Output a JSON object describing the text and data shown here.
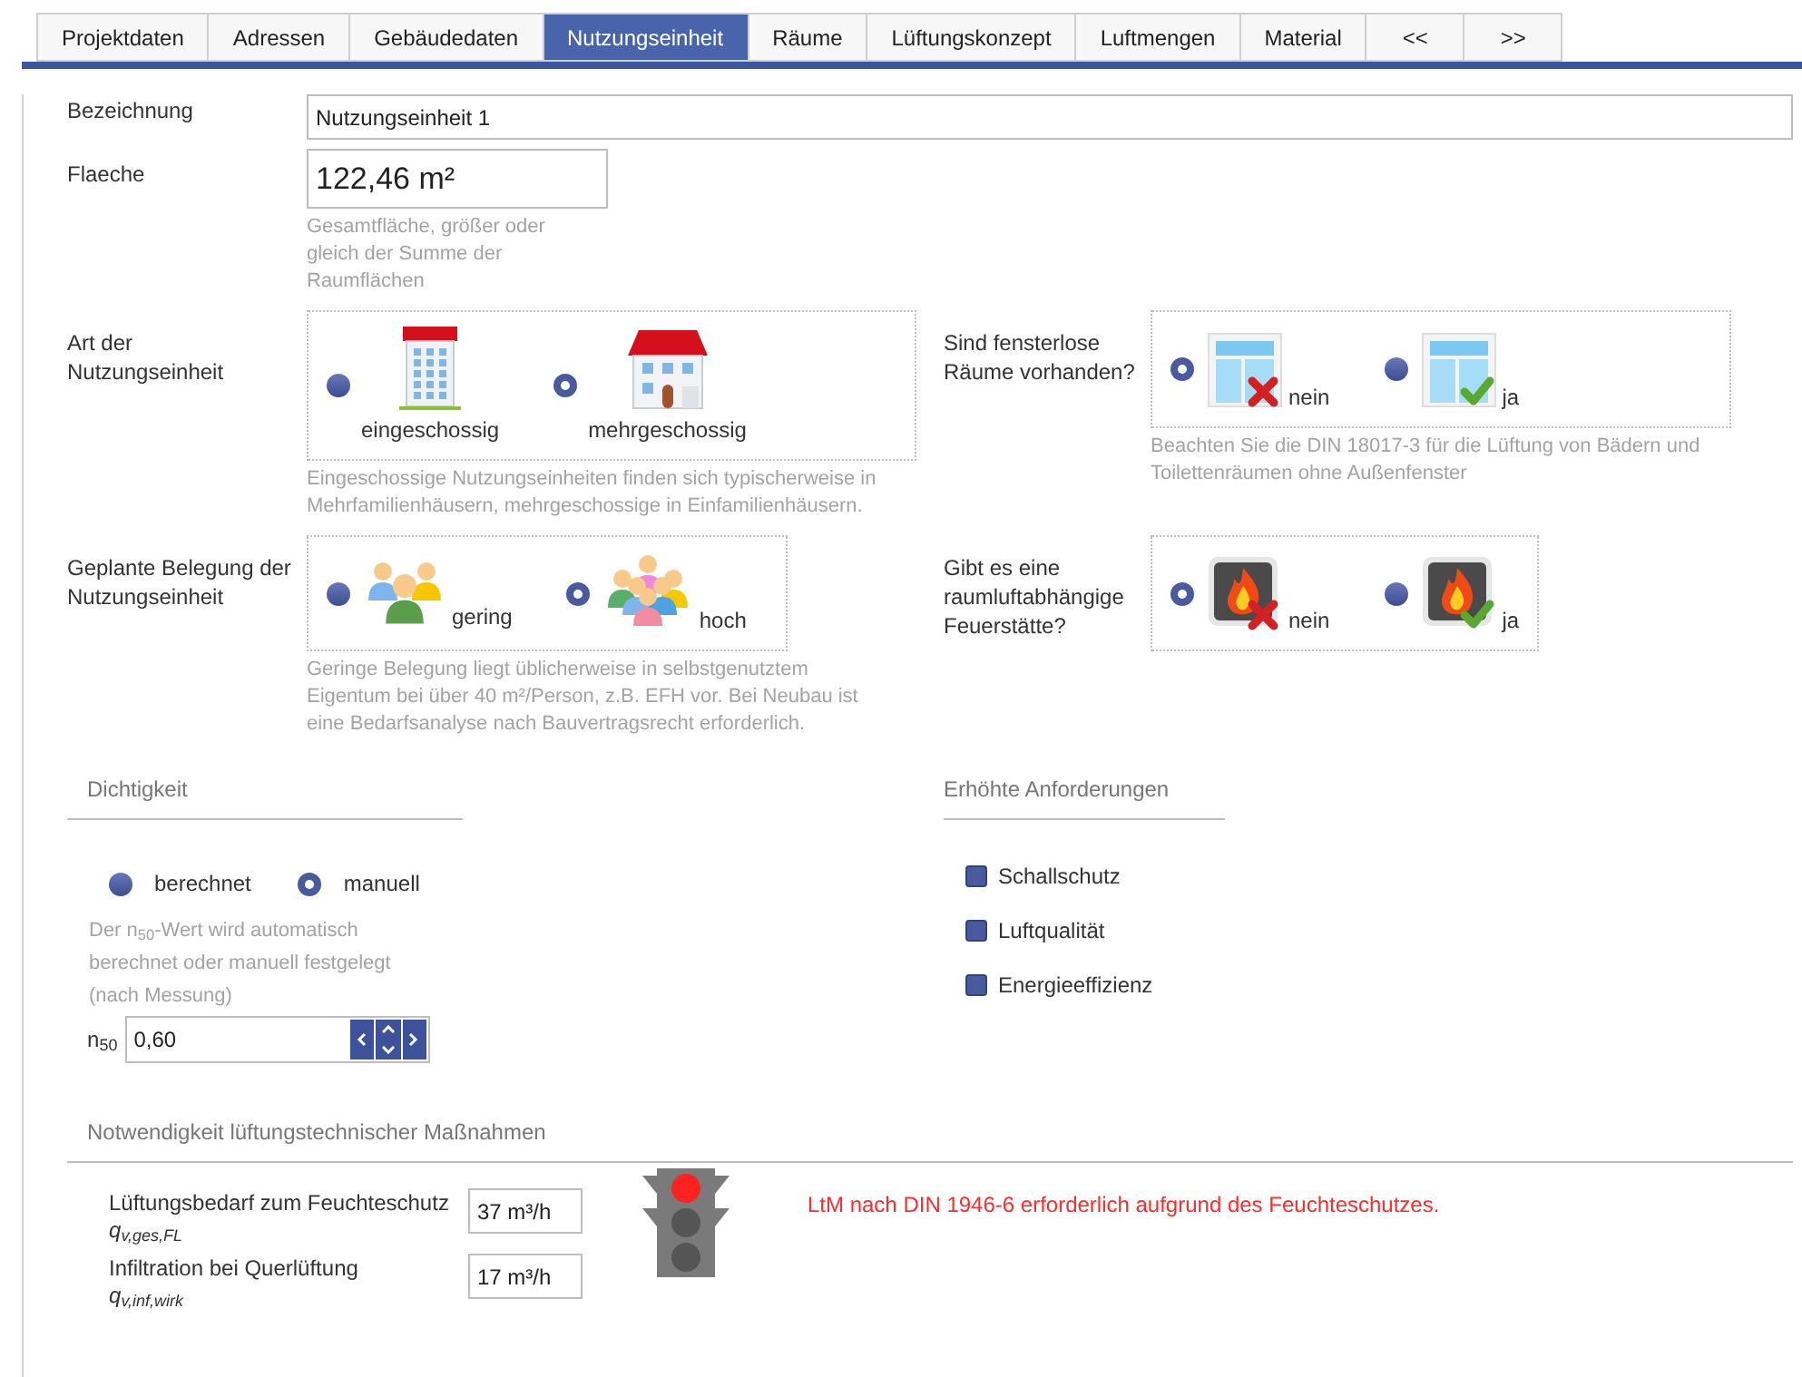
{
  "tabs": [
    {
      "label": "Projektdaten",
      "selected": false
    },
    {
      "label": "Adressen",
      "selected": false
    },
    {
      "label": "Gebäudedaten",
      "selected": false
    },
    {
      "label": "Nutzungseinheit",
      "selected": true
    },
    {
      "label": "Räume",
      "selected": false
    },
    {
      "label": "Lüftungskonzept",
      "selected": false
    },
    {
      "label": "Luftmengen",
      "selected": false
    },
    {
      "label": "Material",
      "selected": false
    },
    {
      "label": "<<",
      "selected": false
    },
    {
      "label": ">>",
      "selected": false
    }
  ],
  "bezeichnung": {
    "label": "Bezeichnung",
    "value": "Nutzungseinheit 1"
  },
  "flaeche": {
    "label": "Flaeche",
    "value": "122,46 m²",
    "hint": "Gesamtfläche, größer oder gleich der Summe der Raumflächen"
  },
  "art": {
    "label": "Art der Nutzungseinheit",
    "hint": "Eingeschossige Nutzungseinheiten finden sich typischerweise in Mehrfamilienhäusern, mehrgeschossige in Einfamilienhäusern.",
    "options": [
      {
        "label": "eingeschossig",
        "selected": false,
        "kind": "apartment"
      },
      {
        "label": "mehrgeschossig",
        "selected": true,
        "kind": "house"
      }
    ]
  },
  "fensterlos": {
    "label": "Sind fensterlose Räume vorhanden?",
    "hint": "Beachten Sie die DIN 18017-3 für die Lüftung von Bädern und Toilettenräumen ohne Außenfenster",
    "options": [
      {
        "label": "nein",
        "selected": true,
        "kind": "window_no"
      },
      {
        "label": "ja",
        "selected": false,
        "kind": "window_yes"
      }
    ]
  },
  "belegung": {
    "label": "Geplante Belegung der Nutzungseinheit",
    "hint": "Geringe Belegung liegt üblicherweise in selbstgenutztem Eigentum bei über 40 m²/Person, z.B. EFH vor. Bei Neubau ist eine Bedarfsanalyse nach Bauvertragsrecht erforderlich.",
    "options": [
      {
        "label": "gering",
        "selected": false,
        "kind": "people_few"
      },
      {
        "label": "hoch",
        "selected": true,
        "kind": "people_many"
      }
    ]
  },
  "feuerstaette": {
    "label": "Gibt es eine raumluftabhängige Feuerstätte?",
    "options": [
      {
        "label": "nein",
        "selected": true,
        "kind": "fire_no"
      },
      {
        "label": "ja",
        "selected": false,
        "kind": "fire_yes"
      }
    ]
  },
  "dichtigkeit": {
    "title": "Dichtigkeit",
    "options": [
      {
        "label": "berechnet",
        "selected": false
      },
      {
        "label": "manuell",
        "selected": true
      }
    ],
    "hint": "Der n$_{50}$-Wert wird automatisch berechnet oder manuell festgelegt (nach Messung)",
    "n50": {
      "label": "n$_{50}$",
      "value": "0,60"
    }
  },
  "anforderungen": {
    "title": "Erhöhte Anforderungen",
    "items": [
      {
        "label": "Schallschutz",
        "checked": false
      },
      {
        "label": "Luftqualität",
        "checked": false
      },
      {
        "label": "Energieeffizienz",
        "checked": false
      }
    ]
  },
  "notwendigkeit": {
    "title": "Notwendigkeit lüftungstechnischer Maßnahmen",
    "rows": [
      {
        "label": "Lüftungsbedarf zum Feuchteschutz",
        "symbol": "q$_{v,ges,FL}$",
        "value": "37 m³/h"
      },
      {
        "label": "Infiltration bei Querlüftung",
        "symbol": "q$_{v,inf,wirk}$",
        "value": "17 m³/h"
      }
    ],
    "traffic_light": {
      "red": true,
      "yellow": false,
      "green": false
    },
    "message": "LtM nach DIN 1946-6 erforderlich aufgrund des Feuchteschutzes."
  }
}
